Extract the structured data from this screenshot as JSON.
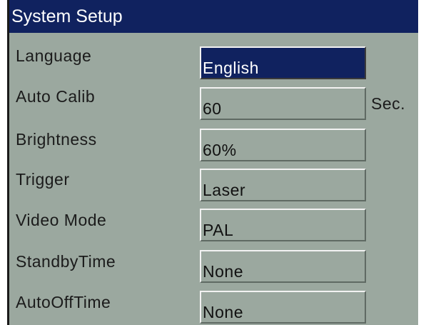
{
  "title": "System Setup",
  "colors": {
    "panel_bg": "#9ba89f",
    "title_bg": "#10225f",
    "selected_bg": "#10225f",
    "text": "#1b1b1b"
  },
  "settings": [
    {
      "label": "Language",
      "value": "English",
      "unit": "",
      "selected": true
    },
    {
      "label": "Auto Calib",
      "value": "60",
      "unit": "Sec.",
      "selected": false
    },
    {
      "label": "Brightness",
      "value": "60%",
      "unit": "",
      "selected": false
    },
    {
      "label": "Trigger",
      "value": "Laser",
      "unit": "",
      "selected": false
    },
    {
      "label": "Video Mode",
      "value": "PAL",
      "unit": "",
      "selected": false
    },
    {
      "label": "StandbyTime",
      "value": "None",
      "unit": "",
      "selected": false
    },
    {
      "label": "AutoOffTime",
      "value": "None",
      "unit": "",
      "selected": false
    }
  ]
}
